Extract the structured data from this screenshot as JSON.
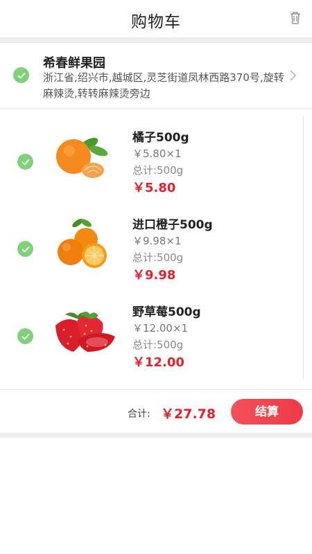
{
  "header": {
    "title": "购物车",
    "trash_icon": "trash-icon"
  },
  "store": {
    "name": "希春鲜果园",
    "address": "浙江省,绍兴市,越城区,灵芝街道凤林西路370号,旋转麻辣烫,转转麻辣烫旁边",
    "selected": true
  },
  "items": [
    {
      "name": "橘子500g",
      "unit_price": "￥5.80×1",
      "total_weight": "总计:500g",
      "price": "￥5.80",
      "image": "mandarin-orange",
      "selected": true
    },
    {
      "name": "进口橙子500g",
      "unit_price": "￥9.98×1",
      "total_weight": "总计:500g",
      "price": "￥9.98",
      "image": "orange",
      "selected": true
    },
    {
      "name": "野草莓500g",
      "unit_price": "￥12.00×1",
      "total_weight": "总计:500g",
      "price": "￥12.00",
      "image": "strawberry",
      "selected": true
    }
  ],
  "footer": {
    "total_label": "合计:",
    "total_value": "￥27.78",
    "checkout_label": "结算"
  },
  "colors": {
    "accent_red": "#e5202e",
    "check_green": "#7fd27a",
    "divider_gray": "#eeeeee"
  }
}
